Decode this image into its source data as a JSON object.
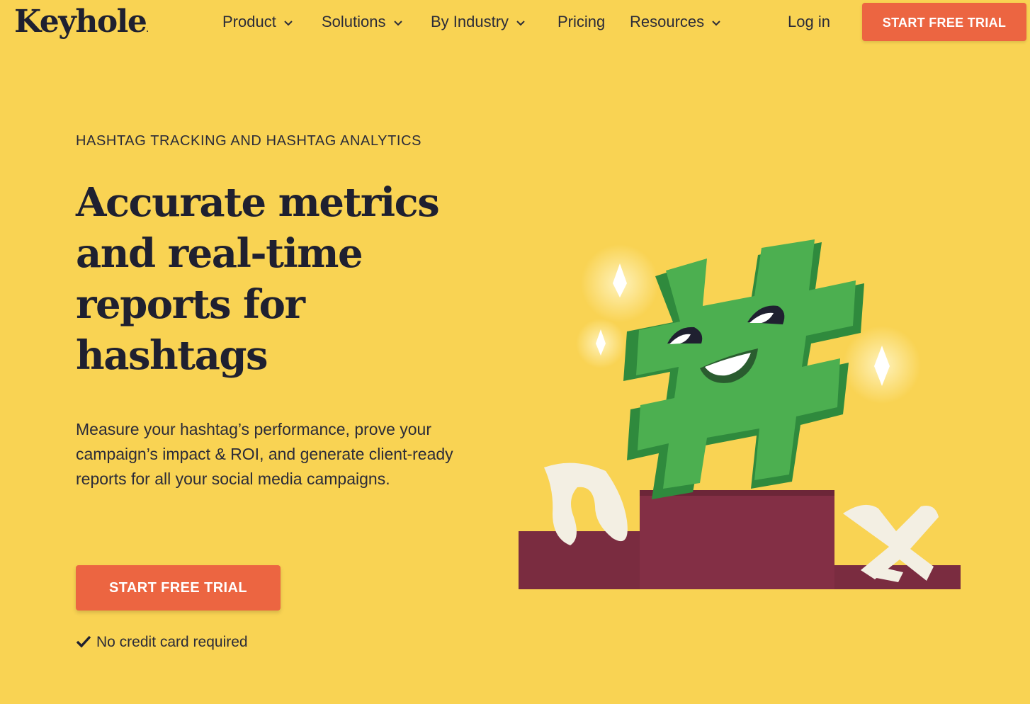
{
  "brand": {
    "name": "Keyhole",
    "dot": "."
  },
  "nav": {
    "items": [
      {
        "label": "Product",
        "has_dropdown": true
      },
      {
        "label": "Solutions",
        "has_dropdown": true
      },
      {
        "label": "By Industry",
        "has_dropdown": true
      },
      {
        "label": "Pricing",
        "has_dropdown": false
      },
      {
        "label": "Resources",
        "has_dropdown": true
      }
    ],
    "login_label": "Log in",
    "cta_label": "START FREE TRIAL",
    "dropdown_icon": "chevron-down-icon"
  },
  "hero": {
    "eyebrow": "HASHTAG TRACKING AND HASHTAG ANALYTICS",
    "headline": "Accurate metrics and real-time reports for hashtags",
    "description": "Measure your hashtag’s performance, prove your campaign’s impact & ROI, and generate client-ready reports for all your social media campaigns.",
    "cta_label": "START FREE TRIAL",
    "note": "No credit card required",
    "note_icon": "checkmark-icon"
  },
  "illustration": {
    "subject": "hashtag-character-on-podium",
    "icons": [
      "hashtag-mascot-icon",
      "sparkle-icon",
      "podium-icon"
    ]
  },
  "colors": {
    "background": "#f9d353",
    "accent": "#ec6541",
    "text": "#1f2030",
    "hashtag_green": "#4caf50",
    "podium": "#7a2c40"
  }
}
